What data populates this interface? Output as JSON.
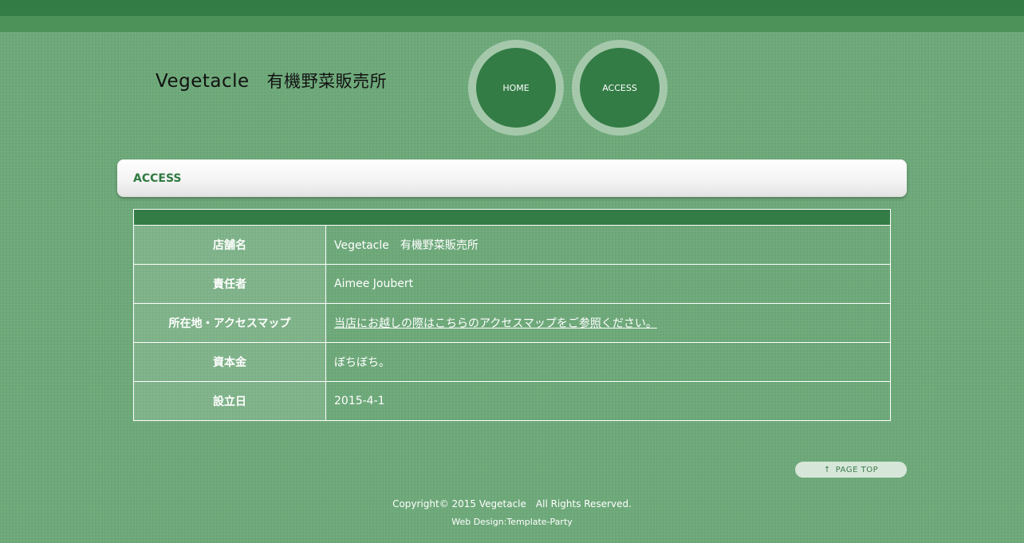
{
  "header": {
    "logo_name": "Vegetacle",
    "logo_subtitle": "有機野菜販売所"
  },
  "nav": {
    "home": "HOME",
    "access": "ACCESS"
  },
  "section": {
    "title": "ACCESS"
  },
  "table": {
    "rows": [
      {
        "label": "店舗名",
        "value": "Vegetacle　有機野菜販売所"
      },
      {
        "label": "責任者",
        "value": "Aimee Joubert"
      },
      {
        "label": "所在地・アクセスマップ",
        "value": "当店にお越しの際はこちらのアクセスマップをご参照ください。"
      },
      {
        "label": "資本金",
        "value": "ぼちぼち。"
      },
      {
        "label": "設立日",
        "value": "2015-4-1"
      }
    ]
  },
  "page_top": {
    "arrow": "↑",
    "label": "PAGE TOP"
  },
  "footer": {
    "copyright": "Copyright© 2015 Vegetacle　All Rights Reserved.",
    "web_design": "Web Design:Template-Party"
  },
  "colors": {
    "background": "#6ea97a",
    "accent": "#337c45",
    "nav_ring": "#a5c8ab",
    "heading_text": "#2f7a3f"
  }
}
